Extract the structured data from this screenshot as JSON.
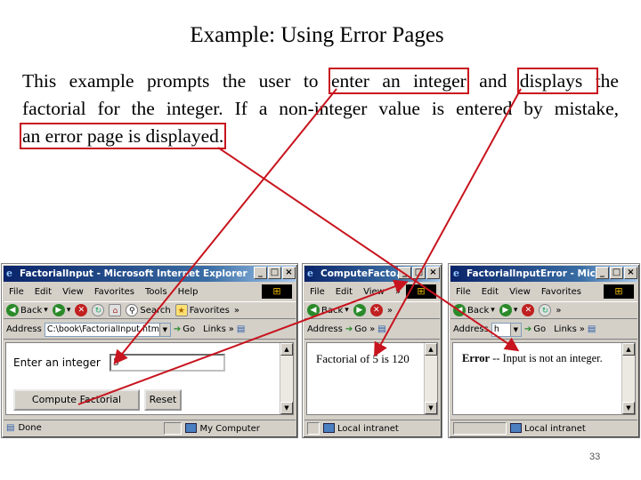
{
  "slide": {
    "title": "Example: Using Error Pages",
    "body": {
      "line1_before": "This example prompts the user to ",
      "hl_enter": "enter an integer",
      "line1_mid": " and ",
      "hl_display": "displays ",
      "line1_after": "the",
      "line2": "factorial for the integer. If a non-integer value is entered by mistake,",
      "hl_error": "an error page is displayed."
    },
    "page_number": "33"
  },
  "colors": {
    "highlight": "#c8141e",
    "titlebar": "#0a246a"
  },
  "menu_labels": [
    "File",
    "Edit",
    "View",
    "Favorites",
    "Tools",
    "Help"
  ],
  "toolbar": {
    "back": "Back",
    "search": "Search",
    "favorites": "Favorites"
  },
  "common": {
    "address": "Address",
    "go": "Go",
    "links": "Links"
  },
  "windows": {
    "input": {
      "title": "FactorialInput - Microsoft Internet Explorer",
      "address": "C:\\book\\FactorialInput.html",
      "prompt": "Enter an integer",
      "value": "5",
      "compute_button": "Compute Factorial",
      "reset_button": "Reset",
      "status": "Done",
      "zone": "My Computer"
    },
    "compute": {
      "title": "ComputeFacto...",
      "result": "Factorial of 5 is 120",
      "zone": "Local intranet"
    },
    "error": {
      "title": "FactorialInputError - Micr...",
      "address": "h",
      "error_label": "Error",
      "error_message": " -- Input is not an integer.",
      "zone": "Local intranet"
    }
  }
}
